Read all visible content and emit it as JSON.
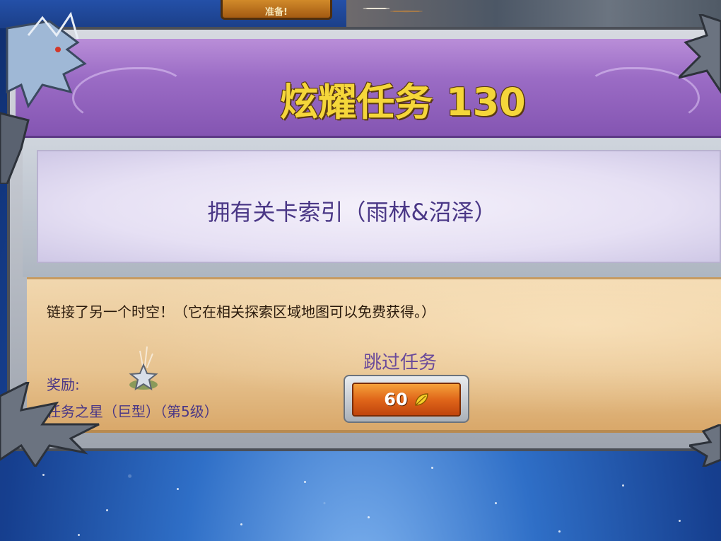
{
  "header": {
    "ready_label": "准备!"
  },
  "quest": {
    "title": "炫耀任务 130",
    "objective": "拥有关卡索引（雨林&沼泽）",
    "story": "链接了另一个时空！（它在相关探索区域地图可以免费获得。）"
  },
  "reward": {
    "label": "奖励:",
    "name": "任务之星（巨型）（第5级）",
    "icon": "star-icon"
  },
  "skip": {
    "label": "跳过任务",
    "cost": "60",
    "currency_icon": "leaf-icon"
  },
  "colors": {
    "title_banner": "#9b6cc5",
    "title_text": "#f5d63a",
    "objective_text": "#4a3786",
    "parchment": "#e7c390",
    "button": "#e0661a"
  }
}
